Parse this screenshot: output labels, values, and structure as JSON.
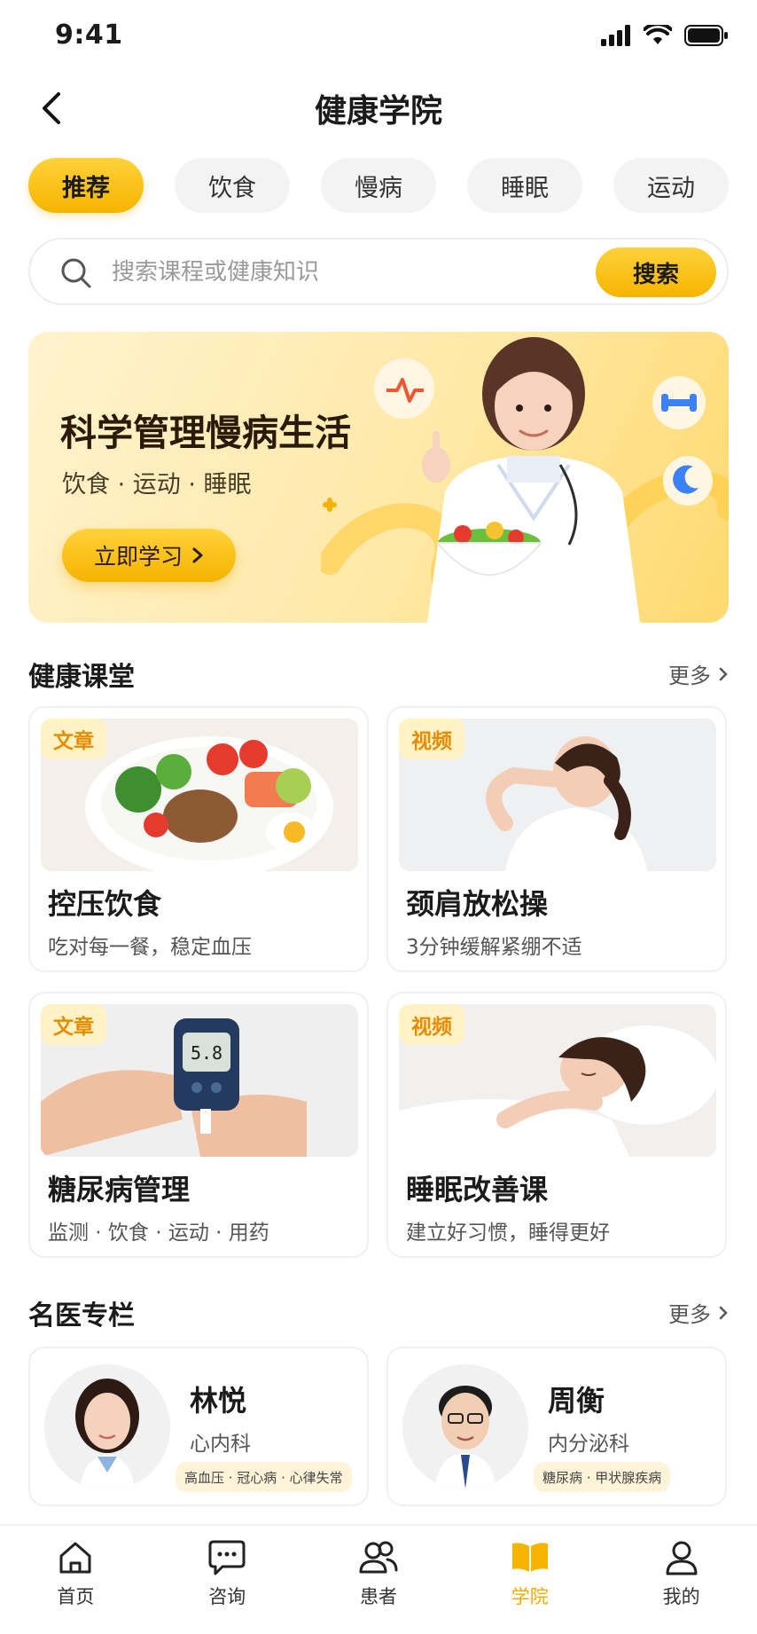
{
  "status_bar": {
    "time": "9:41"
  },
  "header": {
    "title": "健康学院"
  },
  "tabs": [
    {
      "label": "推荐",
      "active": true
    },
    {
      "label": "饮食",
      "active": false
    },
    {
      "label": "慢病",
      "active": false
    },
    {
      "label": "睡眠",
      "active": false
    },
    {
      "label": "运动",
      "active": false
    }
  ],
  "search": {
    "placeholder": "搜索课程或健康知识",
    "button_label": "搜索"
  },
  "banner": {
    "title": "科学管理慢病生活",
    "subtitle": "饮食 · 运动 · 睡眠",
    "button_label": "立即学习"
  },
  "health_class": {
    "title": "健康课堂",
    "more_label": "更多",
    "cards": [
      {
        "badge": "文章",
        "title": "控压饮食",
        "desc": "吃对每一餐，稳定血压",
        "image": "salad-bowl"
      },
      {
        "badge": "视频",
        "title": "颈肩放松操",
        "desc": "3分钟缓解紧绷不适",
        "image": "neck-stretch"
      },
      {
        "badge": "文章",
        "title": "糖尿病管理",
        "desc": "监测 · 饮食 · 运动 · 用药",
        "image": "glucose-meter",
        "meter_reading": "5.8"
      },
      {
        "badge": "视频",
        "title": "睡眠改善课",
        "desc": "建立好习惯，睡得更好",
        "image": "sleeping-woman"
      }
    ]
  },
  "doctors": {
    "title": "名医专栏",
    "more_label": "更多",
    "items": [
      {
        "name": "林悦",
        "dept": "心内科",
        "tags": "高血压 · 冠心病 · 心律失常",
        "avatar": "female-doctor-avatar"
      },
      {
        "name": "周衡",
        "dept": "内分泌科",
        "tags": "糖尿病 · 甲状腺疾病",
        "avatar": "male-doctor-avatar"
      }
    ]
  },
  "tabbar": [
    {
      "label": "首页",
      "icon": "home-icon",
      "active": false
    },
    {
      "label": "咨询",
      "icon": "chat-icon",
      "active": false
    },
    {
      "label": "患者",
      "icon": "patients-icon",
      "active": false
    },
    {
      "label": "学院",
      "icon": "book-icon",
      "active": true
    },
    {
      "label": "我的",
      "icon": "profile-icon",
      "active": false
    }
  ],
  "colors": {
    "accent": "#f6b400",
    "accent_light": "#ffd23a",
    "badge_bg": "#fff2c4",
    "badge_text": "#e78c00"
  }
}
